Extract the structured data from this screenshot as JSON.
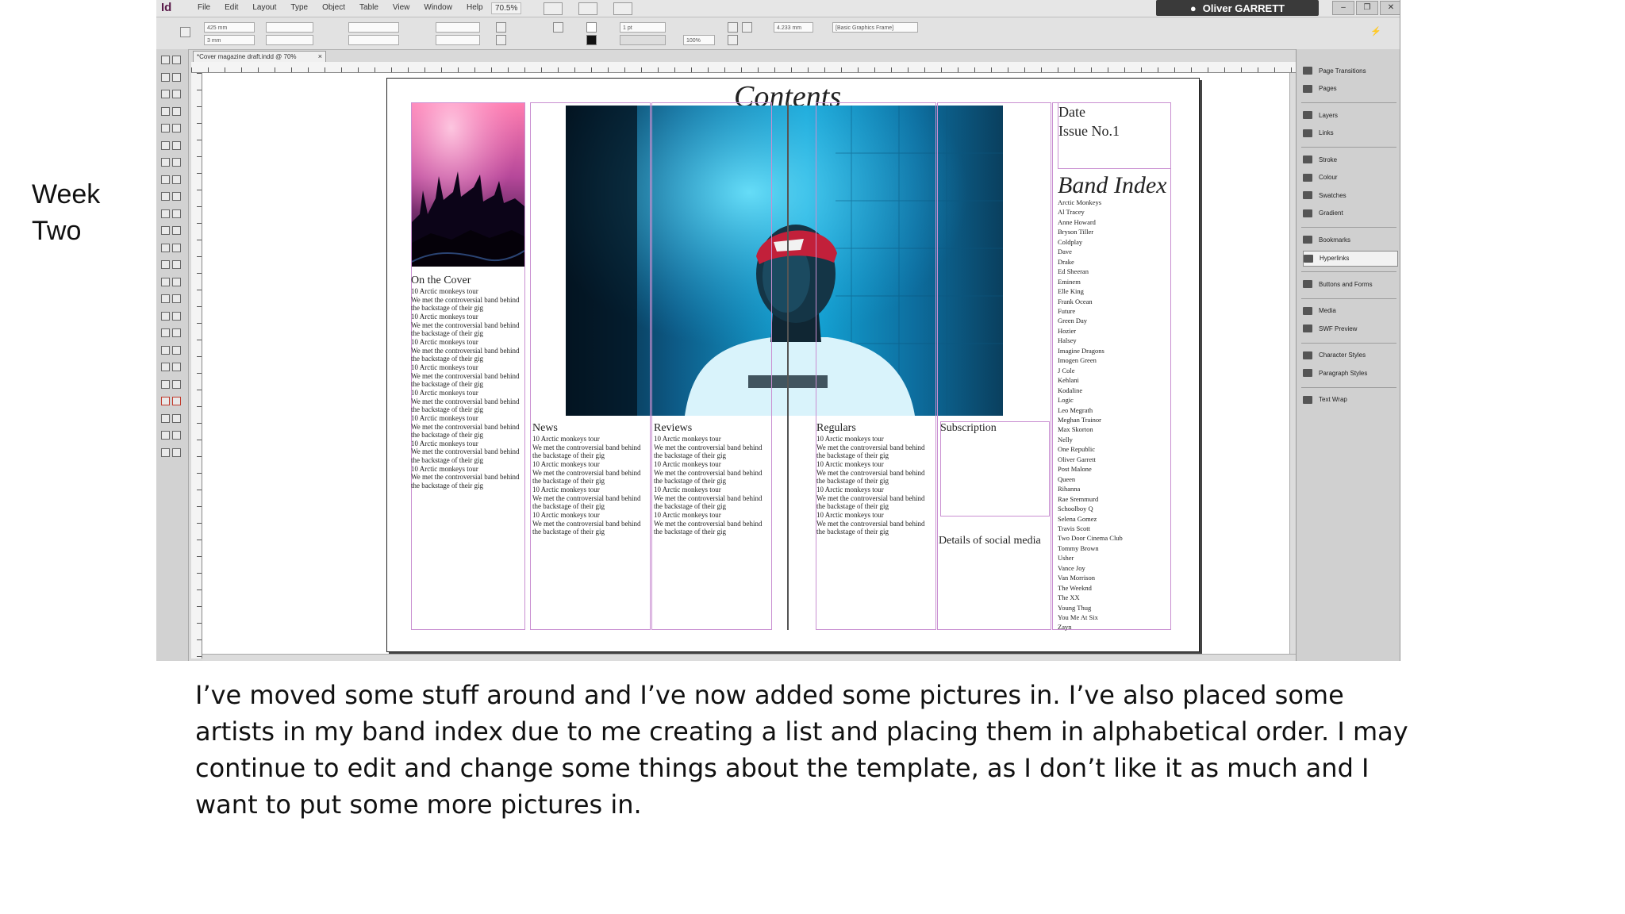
{
  "slide": {
    "label": "Week Two",
    "caption": "I’ve moved some stuff around and I’ve now added some pictures in. I’ve also placed some artists in my band index due to me creating a list and placing them in alphabetical order. I may continue to edit and change some things about the template, as I don’t like it as much and I want to put some more pictures in."
  },
  "app": {
    "logo": "Id",
    "menus": [
      "File",
      "Edit",
      "Layout",
      "Type",
      "Object",
      "Table",
      "View",
      "Window",
      "Help"
    ],
    "zoom": "70.5%",
    "user": "Oliver GARRETT",
    "window_buttons": [
      "–",
      "❐",
      "✕"
    ],
    "control_panel": {
      "x": "425 mm",
      "y": "3 mm",
      "stroke_weight": "1 pt",
      "scale": "100%",
      "ref_width": "4.233 mm",
      "frame_style": "[Basic Graphics Frame]"
    },
    "document_tab": "*Cover magazine draft.indd @ 70%",
    "tab_close": "×"
  },
  "page": {
    "contents_title": "Contents",
    "date": "Date",
    "issue": "Issue No.1",
    "band_index_title": "Band Index",
    "on_the_cover_heading": "On the Cover",
    "news_heading": "News",
    "reviews_heading": "Reviews",
    "regulars_heading": "Regulars",
    "subscription_heading": "Subscription",
    "social_heading": "Details of social media",
    "cover_blurb": "10 Arctic monkeys tour\nWe met the controversial band behind the backstage of their gig\n10 Arctic monkeys tour\nWe met the controversial band behind the backstage of their gig\n10 Arctic monkeys tour\nWe met the controversial band behind the backstage of their gig\n10 Arctic monkeys tour\nWe met the controversial band behind the backstage of their gig\n10 Arctic monkeys tour\nWe met the controversial band behind the backstage of their gig\n10 Arctic monkeys tour\nWe met the controversial band behind the backstage of their gig\n10 Arctic monkeys tour\nWe met the controversial band behind the backstage of their gig\n10 Arctic monkeys tour\nWe met the controversial band behind the backstage of their gig",
    "column_blurb": "10 Arctic monkeys tour\nWe met the controversial band behind the backstage of their gig\n10 Arctic monkeys tour\nWe met the controversial band behind the backstage of their gig\n10 Arctic monkeys tour\nWe met the controversial band behind the backstage of their gig\n10 Arctic monkeys tour\nWe met the controversial band behind the backstage of their gig",
    "band_index": [
      "Arctic Monkeys",
      "Al Tracey",
      "Anne Howard",
      "Bryson Tiller",
      "Coldplay",
      "Dave",
      "Drake",
      "Ed Sheeran",
      "Eminem",
      "Elle King",
      "Frank Ocean",
      "Future",
      "Green Day",
      "Hozier",
      "Halsey",
      "Imagine Dragons",
      "Imogen Green",
      "J Cole",
      "Kehlani",
      "Kodaline",
      "Logic",
      "Leo Megrath",
      "Meghan Trainor",
      "Max Skorton",
      "Nelly",
      "One Republic",
      "Oliver Garrett",
      "Post Malone",
      "Queen",
      "Rihanna",
      "Rae Sremmurd",
      "Schoolboy Q",
      "Selena Gomez",
      "Travis Scott",
      "Two Door Cinema Club",
      "Tommy Brown",
      "Usher",
      "Vance Joy",
      "Van Morrison",
      "The Weeknd",
      "The XX",
      "Young Thug",
      "You Me At Six",
      "Zayn"
    ]
  },
  "panels": [
    "Page Transitions",
    "Pages",
    "Layers",
    "Links",
    "Stroke",
    "Colour",
    "Swatches",
    "Gradient",
    "Bookmarks",
    "Hyperlinks",
    "Buttons and Forms",
    "Media",
    "SWF Preview",
    "Character Styles",
    "Paragraph Styles",
    "Text Wrap"
  ],
  "selected_panel": "Hyperlinks"
}
